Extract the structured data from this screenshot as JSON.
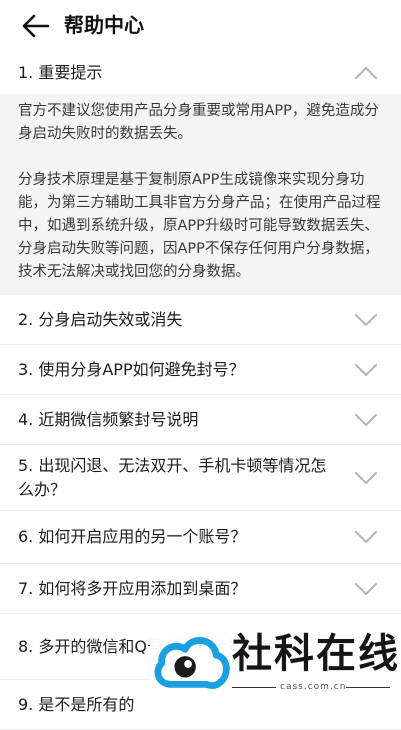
{
  "header": {
    "title": "帮助中心"
  },
  "items": [
    {
      "label": "1. 重要提示",
      "body_p1": "官方不建议您使用产品分身重要或常用APP，避免造成分身启动失败时的数据丢失。",
      "body_p2": "分身技术原理是基于复制原APP生成镜像来实现分身功能，为第三方辅助工具非官方分身产品；在使用产品过程中，如遇到系统升级，原APP升级时可能导致数据丢失、分身启动失败等问题，因APP不保存任何用户分身数据，技术无法解决或找回您的分身数据。"
    },
    {
      "label": "2. 分身启动失效或消失"
    },
    {
      "label": "3. 使用分身APP如何避免封号？"
    },
    {
      "label": "4. 近期微信频繁封号说明"
    },
    {
      "label": "5. 出现闪退、无法双开、手机卡顿等情况怎么办？"
    },
    {
      "label": "6. 如何开启应用的另一个账号？"
    },
    {
      "label": "7. 如何将多开应用添加到桌面？"
    },
    {
      "label": "8. 多开的微信和Q号会影响大号的使用吗？"
    },
    {
      "label": "9. 是不是所有的"
    }
  ],
  "watermark": {
    "text": "社科在线",
    "url": "cass.com.cn"
  },
  "colors": {
    "watermark_blue": "#1aa0e0",
    "divider": "#eeeeee",
    "body_bg": "#f4f4f4"
  }
}
